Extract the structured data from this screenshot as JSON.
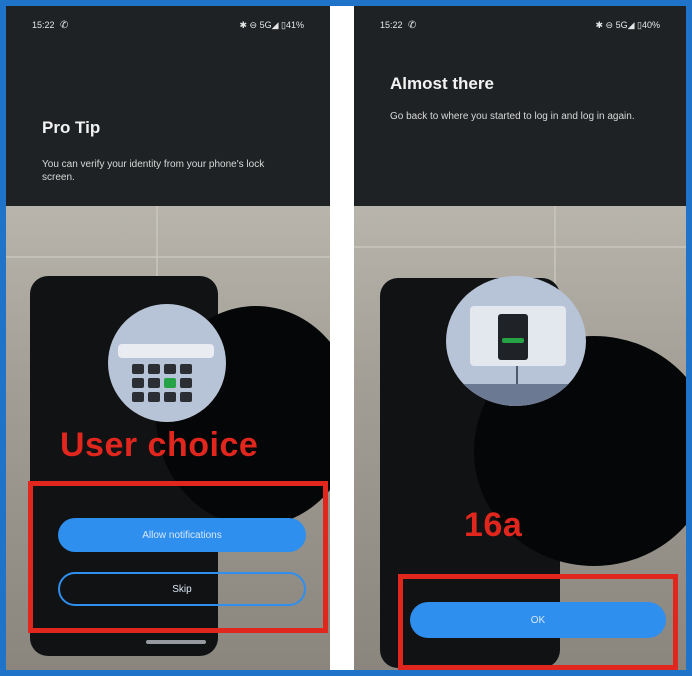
{
  "left": {
    "status": {
      "time": "15:22",
      "indicators": "✱ ⊖ 5G◢ ▯41%"
    },
    "title": "Pro Tip",
    "body": "You can verify your identity from your phone's lock screen.",
    "overlay_label": "User choice",
    "buttons": {
      "primary": "Allow notifications",
      "secondary": "Skip"
    },
    "colors": {
      "accent": "#2f8fee",
      "annotation": "#e0261d"
    }
  },
  "right": {
    "status": {
      "time": "15:22",
      "indicators": "✱ ⊖ 5G◢ ▯40%"
    },
    "title": "Almost there",
    "body": "Go back to where you started to log in and log in again.",
    "overlay_label": "16a",
    "buttons": {
      "primary": "OK"
    }
  }
}
